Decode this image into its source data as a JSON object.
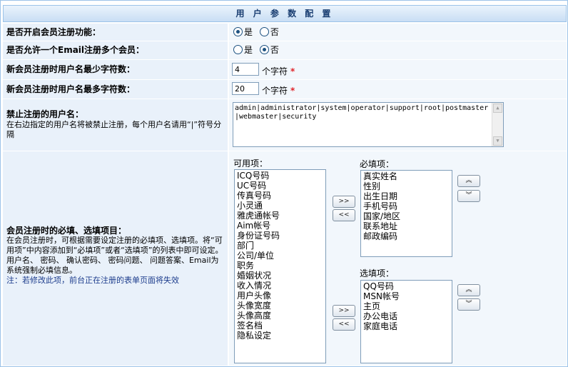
{
  "header": {
    "title": "用 户 参 数 配 置"
  },
  "rows": {
    "enable_reg": {
      "label": "是否开启会员注册功能：",
      "yes": "是",
      "no": "否",
      "selected": "yes"
    },
    "multi_email": {
      "label": "是否允许一个Email注册多个会员：",
      "yes": "是",
      "no": "否",
      "selected": "no"
    },
    "min_len": {
      "label": "新会员注册时用户名最少字符数：",
      "value": "4",
      "unit": "个字符",
      "required": "*"
    },
    "max_len": {
      "label": "新会员注册时用户名最多字符数：",
      "value": "20",
      "unit": "个字符",
      "required": "*"
    },
    "banned": {
      "label": "禁止注册的用户名：",
      "desc": "在右边指定的用户名将被禁止注册，每个用户名请用“|”符号分隔",
      "value": "admin|administrator|system|operator|support|root|postmaster|webmaster|security"
    },
    "fields": {
      "label": "会员注册时的必填、选填项目：",
      "desc1": "在会员注册时，可根据需要设定注册的必填项、选填项。将“可用项”中内容添加到“必填项”或者“选填项”的列表中即可设定。",
      "desc2": "用户名、 密码、 确认密码、 密码问题、 问题答案、Email为系统强制必填信息。",
      "note": "注：若修改此项，前台正在注册的表单页面将失效",
      "available_caption": "可用项：",
      "required_caption": "必填项：",
      "optional_caption": "选填项：",
      "available": [
        "ICQ号码",
        "UC号码",
        "传真号码",
        "小灵通",
        "雅虎通帐号",
        "Aim帐号",
        "身份证号码",
        "部门",
        "公司/单位",
        "职务",
        "婚姻状况",
        "收入情况",
        "用户头像",
        "头像宽度",
        "头像高度",
        "签名档",
        "隐私设定"
      ],
      "required": [
        "真实姓名",
        "性别",
        "出生日期",
        "手机号码",
        "国家/地区",
        "联系地址",
        "邮政编码"
      ],
      "optional": [
        "QQ号码",
        "MSN帐号",
        "主页",
        "办公电话",
        "家庭电话"
      ],
      "btn_add": ">>",
      "btn_remove": "<<",
      "btn_up": "︽",
      "btn_down": "︾"
    }
  }
}
